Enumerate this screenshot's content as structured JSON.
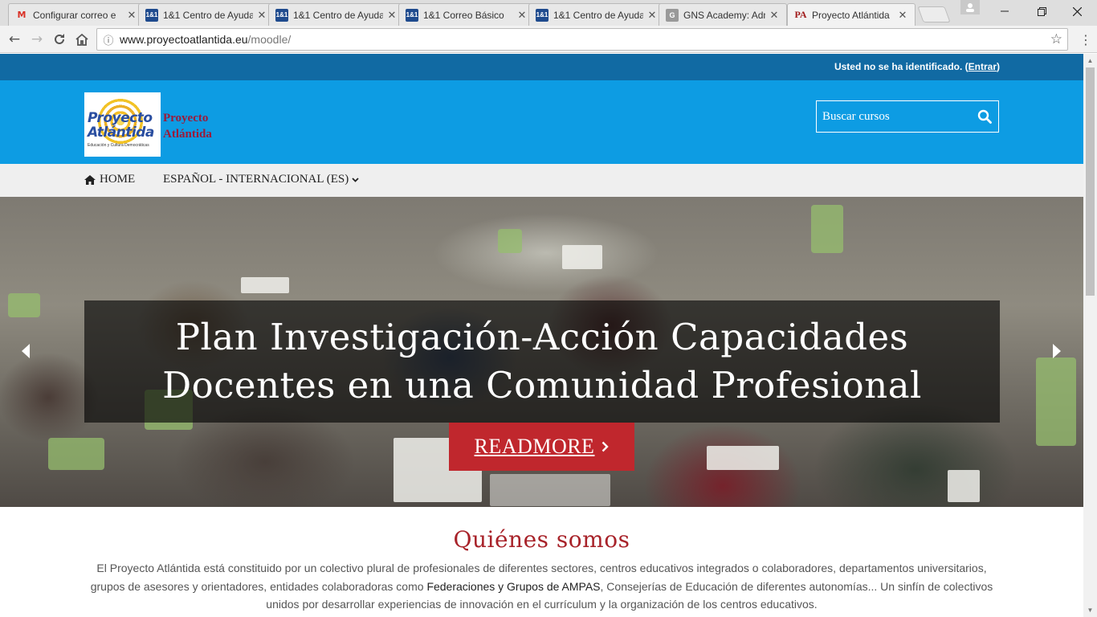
{
  "browser": {
    "tabs": [
      {
        "title": "Configurar correo e",
        "favicon": "gmail-icon",
        "active": false
      },
      {
        "title": "1&1 Centro de Ayuda",
        "favicon": "one-and-one-icon",
        "active": false
      },
      {
        "title": "1&1 Centro de Ayuda",
        "favicon": "one-and-one-icon",
        "active": false
      },
      {
        "title": "1&1 Correo Básico",
        "favicon": "one-and-one-icon",
        "active": false
      },
      {
        "title": "1&1 Centro de Ayuda",
        "favicon": "one-and-one-icon",
        "active": false
      },
      {
        "title": "GNS Academy: Adm",
        "favicon": "gns-icon",
        "active": false
      },
      {
        "title": "Proyecto Atlántida",
        "favicon": "pa-icon",
        "active": true
      }
    ],
    "url_host": "www.proyectoatlantida.eu",
    "url_path": "/moodle/"
  },
  "topbar": {
    "status_text": "Usted no se ha identificado. (",
    "login_link": "Entrar",
    "status_close": ")"
  },
  "header": {
    "logo_text_line1": "Proyecto",
    "logo_text_line2": "Atlántida",
    "logo_tagline": "Educación y Cultura Democráticas",
    "brand_line1": "Proyecto",
    "brand_line2": "Atlántida",
    "search_placeholder": "Buscar cursos"
  },
  "nav": {
    "home_label": "HOME",
    "language_label": "ESPAÑOL - INTERNACIONAL (ES)"
  },
  "hero": {
    "title_line1": "Plan Investigación-Acción Capacidades",
    "title_line2": "Docentes en una Comunidad Profesional",
    "button_label": "READMORE"
  },
  "about": {
    "heading": "Quiénes somos",
    "text_before": "El Proyecto Atlántida está constituido por un colectivo plural de profesionales de diferentes sectores, centros educativos integrados o colaboradores, departamentos universitarios, grupos de asesores y orientadores, entidades colaboradoras como ",
    "text_highlight": "Federaciones y Grupos de AMPAS",
    "text_after": ", Consejerías de Educación de diferentes autonomías... Un sinfín de colectivos unidos por desarrollar experiencias de innovación en el currículum y la organización de los centros educativos."
  },
  "colors": {
    "topbar": "#116aa3",
    "header": "#0d9ce3",
    "accent_red": "#c0272d",
    "heading_red": "#a8232a"
  }
}
